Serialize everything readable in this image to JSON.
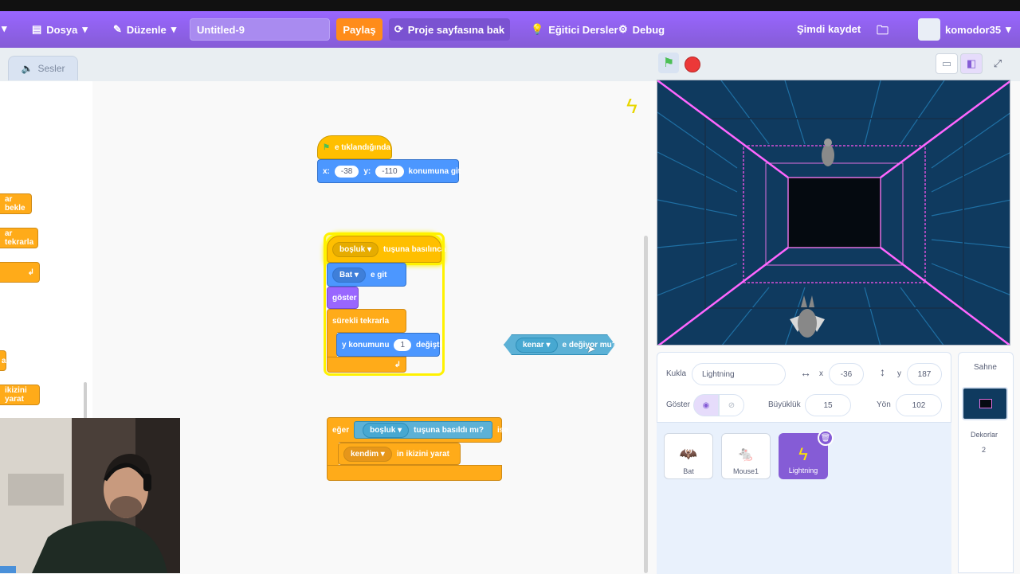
{
  "menubar": {
    "file": "Dosya",
    "edit": "Düzenle",
    "project_title": "Untitled-9",
    "share": "Paylaş",
    "see_project": "Proje sayfasına bak",
    "tutorials": "Eğitici Dersler",
    "debug": "Debug",
    "save_now": "Şimdi kaydet",
    "username": "komodor35"
  },
  "tabs": {
    "sounds": "Sesler"
  },
  "palette": {
    "blocks": [
      "ar bekle",
      "ar tekrarla",
      "a",
      "ikizini yarat"
    ]
  },
  "scripts": {
    "flag_hat": "e tıklandığında",
    "goto": {
      "x_label": "x:",
      "x": "-38",
      "y_label": "y:",
      "y": "-110",
      "suffix": "konumuna git"
    },
    "key_hat": {
      "key": "boşluk",
      "suffix": "tuşuna basılınca"
    },
    "goto_sprite": {
      "target": "Bat",
      "suffix": "e git"
    },
    "show": "göster",
    "forever": "sürekli tekrarla",
    "change_y": {
      "prefix": "y konumunu",
      "value": "1",
      "suffix": "değiştir"
    },
    "touching": {
      "target": "kenar",
      "suffix": "e değiyor mu?"
    },
    "if_block": {
      "prefix": "eğer",
      "key": "boşluk",
      "cond": "tuşuna basıldı mı?",
      "then": "ise"
    },
    "clone": {
      "target": "kendim",
      "suffix": "in ikizini yarat"
    }
  },
  "sprite_info": {
    "sprite_label": "Kukla",
    "sprite_name": "Lightning",
    "x_label": "x",
    "x": "-36",
    "y_label": "y",
    "y": "187",
    "show_label": "Göster",
    "size_label": "Büyüklük",
    "size": "15",
    "direction_label": "Yön",
    "direction": "102"
  },
  "sprites": [
    {
      "name": "Bat",
      "selected": false
    },
    {
      "name": "Mouse1",
      "selected": false
    },
    {
      "name": "Lightning",
      "selected": true
    }
  ],
  "stage_panel": {
    "title": "Sahne",
    "backdrops_label": "Dekorlar",
    "backdrops_count": "2"
  },
  "colors": {
    "menu": "#855cd6",
    "accent": "#ff8c1a",
    "motion": "#4c97ff",
    "events": "#ffbf00",
    "control": "#ffab19"
  }
}
